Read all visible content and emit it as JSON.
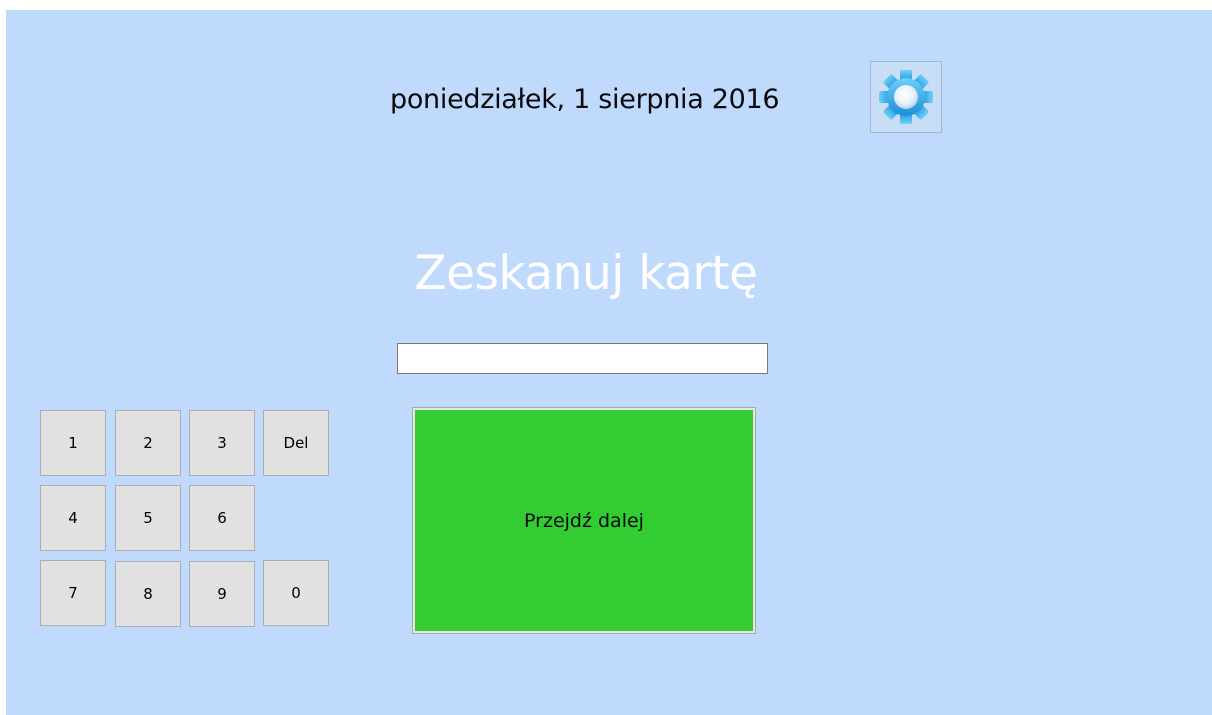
{
  "header": {
    "date_text": "poniedziałek, 1 sierpnia 2016",
    "settings_icon": "gear-icon"
  },
  "main": {
    "title": "Zeskanuj kartę",
    "card_input": {
      "value": "",
      "placeholder": ""
    },
    "next_button_label": "Przejdź dalej"
  },
  "keypad": {
    "keys": [
      "1",
      "2",
      "3",
      "Del",
      "4",
      "5",
      "6",
      "7",
      "8",
      "9",
      "0"
    ]
  },
  "colors": {
    "background": "#bfdafd",
    "next_button": "#33cc33",
    "key_face": "#e1e1e1",
    "title_text": "#ffffff",
    "gear_accent": "#2aa6ea"
  }
}
